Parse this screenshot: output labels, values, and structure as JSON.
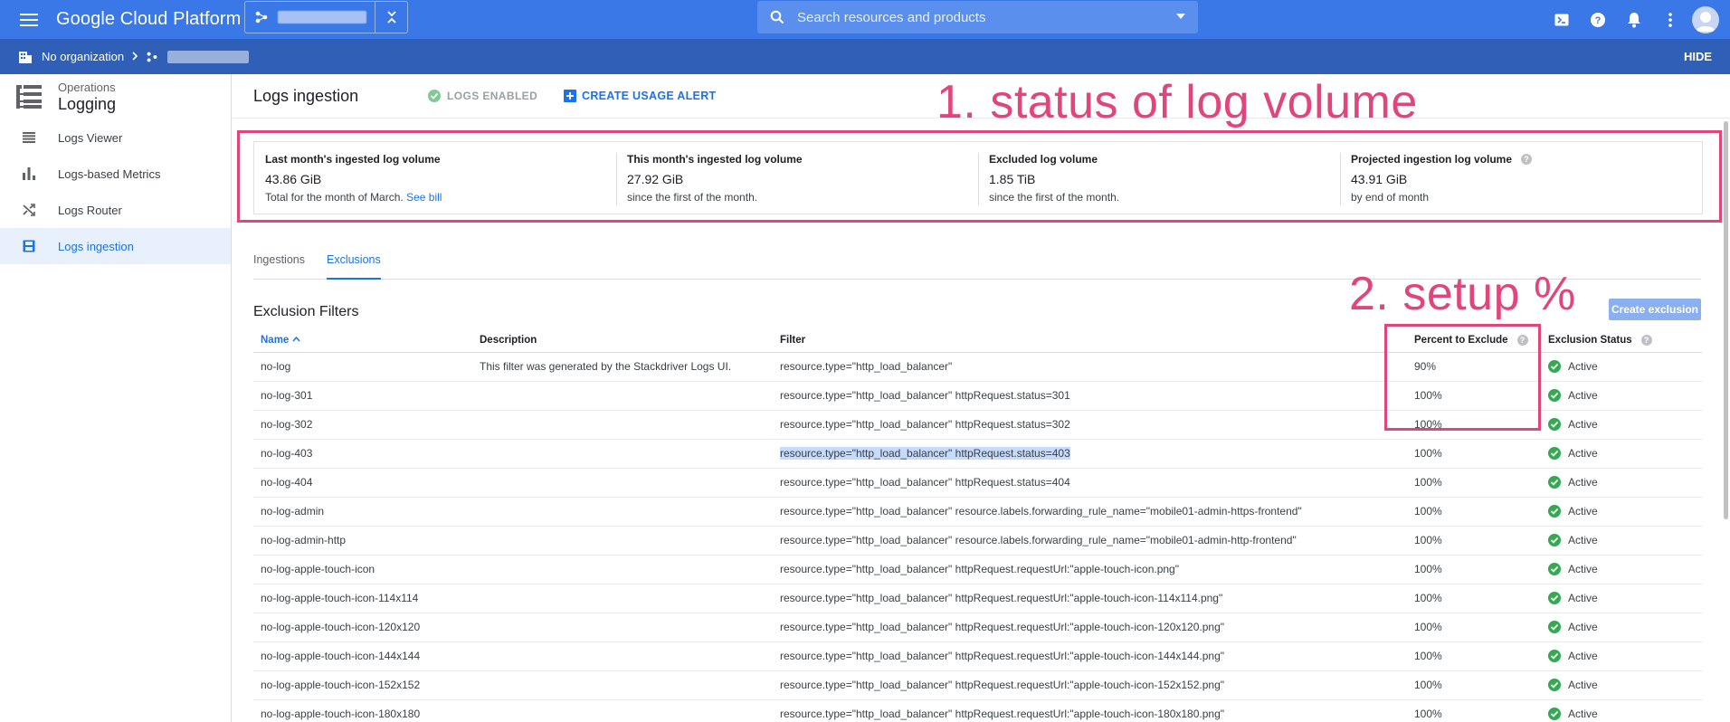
{
  "header": {
    "brand": "Google Cloud Platform",
    "search_placeholder": "Search resources and products"
  },
  "crumbs": {
    "organization": "No organization",
    "hide": "HIDE"
  },
  "sidebar": {
    "section": "Operations",
    "title": "Logging",
    "items": [
      {
        "label": "Logs Viewer"
      },
      {
        "label": "Logs-based Metrics"
      },
      {
        "label": "Logs Router"
      },
      {
        "label": "Logs ingestion"
      }
    ]
  },
  "page": {
    "title": "Logs ingestion",
    "logs_enabled": "LOGS ENABLED",
    "create_alert": "CREATE USAGE ALERT"
  },
  "annotations": {
    "first": "1. status of log volume",
    "second": "2. setup %"
  },
  "stats": [
    {
      "label": "Last month's ingested log volume",
      "value": "43.86 GiB",
      "sub": "Total for the month of March.",
      "link": "See bill"
    },
    {
      "label": "This month's ingested log volume",
      "value": "27.92 GiB",
      "sub": "since the first of the month."
    },
    {
      "label": "Excluded log volume",
      "value": "1.85 TiB",
      "sub": "since the first of the month."
    },
    {
      "label": "Projected ingestion log volume",
      "value": "43.91 GiB",
      "sub": "by end of month"
    }
  ],
  "tabs": [
    "Ingestions",
    "Exclusions"
  ],
  "exclusions": {
    "title": "Exclusion Filters",
    "create_button": "Create exclusion",
    "columns": [
      "Name",
      "Description",
      "Filter",
      "Percent to Exclude",
      "Exclusion Status"
    ],
    "rows": [
      {
        "name": "no-log",
        "description": "This filter was generated by the Stackdriver Logs UI.",
        "filter": "resource.type=\"http_load_balancer\"",
        "percent": "90%",
        "status": "Active"
      },
      {
        "name": "no-log-301",
        "description": "",
        "filter": "resource.type=\"http_load_balancer\" httpRequest.status=301",
        "percent": "100%",
        "status": "Active"
      },
      {
        "name": "no-log-302",
        "description": "",
        "filter": "resource.type=\"http_load_balancer\" httpRequest.status=302",
        "percent": "100%",
        "status": "Active"
      },
      {
        "name": "no-log-403",
        "description": "",
        "filter": "resource.type=\"http_load_balancer\" httpRequest.status=403",
        "percent": "100%",
        "status": "Active"
      },
      {
        "name": "no-log-404",
        "description": "",
        "filter": "resource.type=\"http_load_balancer\" httpRequest.status=404",
        "percent": "100%",
        "status": "Active"
      },
      {
        "name": "no-log-admin",
        "description": "",
        "filter": "resource.type=\"http_load_balancer\" resource.labels.forwarding_rule_name=\"mobile01-admin-https-frontend\"",
        "percent": "100%",
        "status": "Active"
      },
      {
        "name": "no-log-admin-http",
        "description": "",
        "filter": "resource.type=\"http_load_balancer\" resource.labels.forwarding_rule_name=\"mobile01-admin-http-frontend\"",
        "percent": "100%",
        "status": "Active"
      },
      {
        "name": "no-log-apple-touch-icon",
        "description": "",
        "filter": "resource.type=\"http_load_balancer\" httpRequest.requestUrl:\"apple-touch-icon.png\"",
        "percent": "100%",
        "status": "Active"
      },
      {
        "name": "no-log-apple-touch-icon-114x114",
        "description": "",
        "filter": "resource.type=\"http_load_balancer\" httpRequest.requestUrl:\"apple-touch-icon-114x114.png\"",
        "percent": "100%",
        "status": "Active"
      },
      {
        "name": "no-log-apple-touch-icon-120x120",
        "description": "",
        "filter": "resource.type=\"http_load_balancer\" httpRequest.requestUrl:\"apple-touch-icon-120x120.png\"",
        "percent": "100%",
        "status": "Active"
      },
      {
        "name": "no-log-apple-touch-icon-144x144",
        "description": "",
        "filter": "resource.type=\"http_load_balancer\" httpRequest.requestUrl:\"apple-touch-icon-144x144.png\"",
        "percent": "100%",
        "status": "Active"
      },
      {
        "name": "no-log-apple-touch-icon-152x152",
        "description": "",
        "filter": "resource.type=\"http_load_balancer\" httpRequest.requestUrl:\"apple-touch-icon-152x152.png\"",
        "percent": "100%",
        "status": "Active"
      },
      {
        "name": "no-log-apple-touch-icon-180x180",
        "description": "",
        "filter": "resource.type=\"http_load_balancer\" httpRequest.requestUrl:\"apple-touch-icon-180x180.png\"",
        "percent": "100%",
        "status": "Active"
      }
    ]
  },
  "colors": {
    "topbar": "#3b78e7",
    "crumbbar": "#2f5fb7",
    "accent": "#1a73e8",
    "annotation": "#e0457b",
    "active_green": "#34a853"
  }
}
